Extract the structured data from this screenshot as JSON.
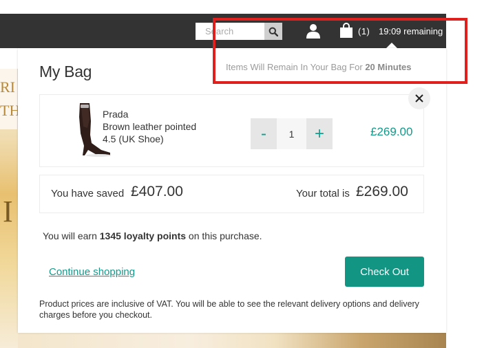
{
  "header": {
    "search": {
      "placeholder": "Search",
      "value": ""
    },
    "bag": {
      "count": "(1)",
      "timer": "19:09 remaining"
    },
    "tooltip": {
      "text_prefix": "Items Will Remain In Your Bag For ",
      "text_bold": "20 Minutes"
    }
  },
  "panel": {
    "title": "My Bag",
    "item": {
      "brand": "Prada",
      "name": "Brown leather pointed",
      "size": "4.5 (UK Shoe)",
      "quantity": "1",
      "minus": "-",
      "plus": "+",
      "price": "£269.00"
    },
    "totals": {
      "saved_label": "You have saved",
      "saved_amount": "£407.00",
      "total_label": "Your total is",
      "total_amount": "£269.00"
    },
    "loyalty": {
      "prefix": "You will earn ",
      "points": "1345 loyalty points",
      "suffix": " on this purchase."
    },
    "continue_label": "Continue shopping",
    "checkout_label": "Check Out",
    "vat_note": "Product prices are inclusive of VAT. You will be able to see the relevant delivery options and delivery charges before you checkout."
  },
  "background": {
    "letters": [
      "RI",
      "TH",
      "I"
    ]
  },
  "colors": {
    "accent": "#139583",
    "topbar": "#333333",
    "highlight": "#e0201c"
  },
  "icons": [
    "search-icon",
    "account-icon",
    "shopping-bag-icon",
    "close-icon",
    "minus-icon",
    "plus-icon"
  ]
}
